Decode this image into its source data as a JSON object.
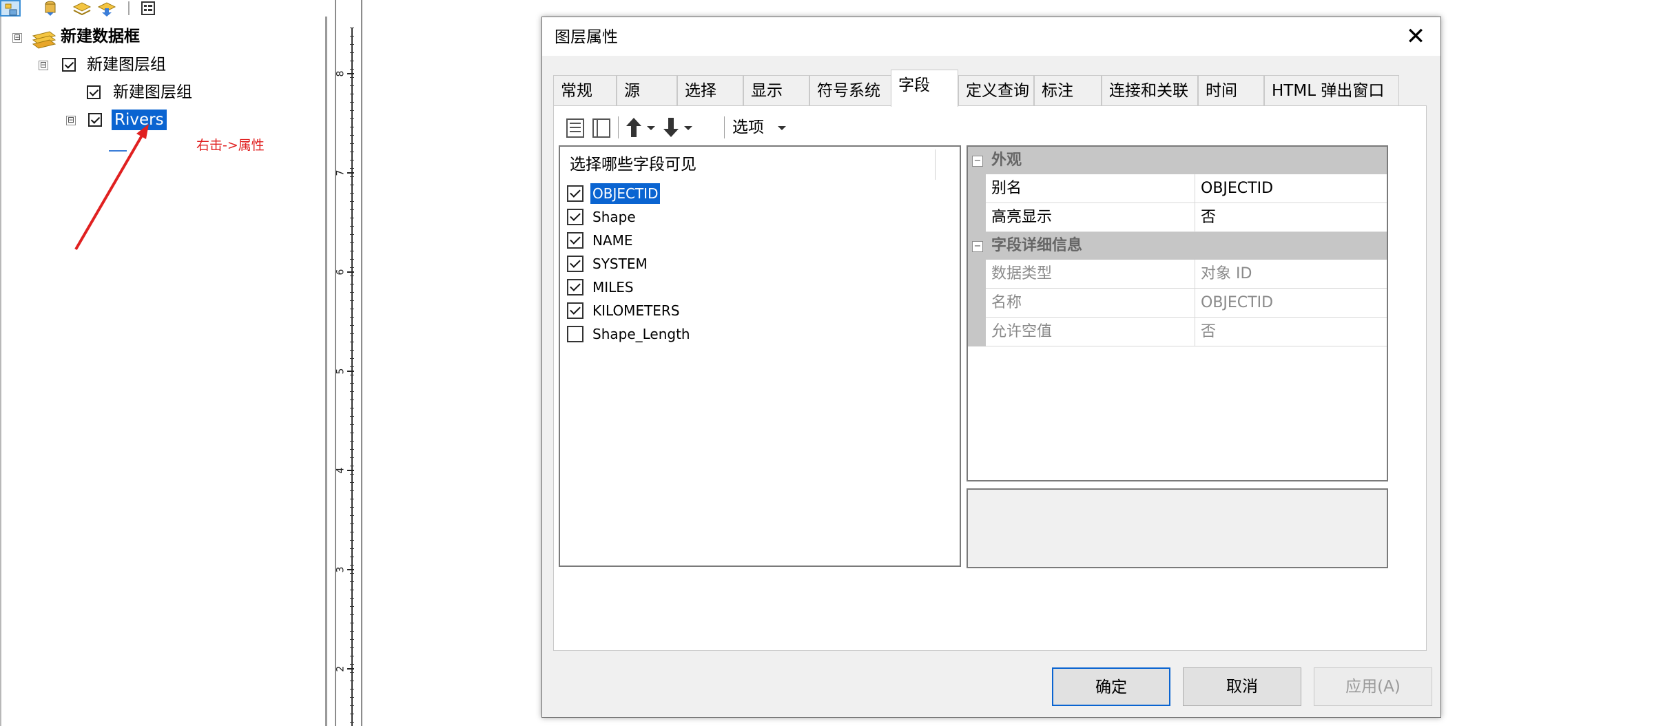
{
  "toc": {
    "data_frame": "新建数据框",
    "group_layer": "新建图层组",
    "sub_group_layer": "新建图层组",
    "rivers_layer": "Rivers",
    "annotation": "右击->属性",
    "expander_collapse_symbol": "⊟"
  },
  "ruler": {
    "ticks": [
      "8",
      "7",
      "6",
      "5",
      "4",
      "3",
      "2"
    ]
  },
  "dialog": {
    "title": "图层属性",
    "close_symbol": "✕",
    "tabs": [
      {
        "label": "常规"
      },
      {
        "label": "源"
      },
      {
        "label": "选择"
      },
      {
        "label": "显示"
      },
      {
        "label": "符号系统"
      },
      {
        "label": "字段"
      },
      {
        "label": "定义查询"
      },
      {
        "label": "标注"
      },
      {
        "label": "连接和关联"
      },
      {
        "label": "时间"
      },
      {
        "label": "HTML 弹出窗口"
      }
    ],
    "active_tab": "字段",
    "toolbar": {
      "options_label": "选项",
      "icons": [
        "list-view-icon",
        "blank-list-icon",
        "arrow-up-icon",
        "dropdown-icon",
        "arrow-down-icon",
        "dropdown-icon"
      ]
    },
    "field_list": {
      "header": "选择哪些字段可见",
      "fields": [
        {
          "name": "OBJECTID",
          "checked": true,
          "selected": true
        },
        {
          "name": "Shape",
          "checked": true,
          "selected": false
        },
        {
          "name": "NAME",
          "checked": true,
          "selected": false
        },
        {
          "name": "SYSTEM",
          "checked": true,
          "selected": false
        },
        {
          "name": "MILES",
          "checked": true,
          "selected": false
        },
        {
          "name": "KILOMETERS",
          "checked": true,
          "selected": false
        },
        {
          "name": "Shape_Length",
          "checked": false,
          "selected": false
        }
      ]
    },
    "property_grid": {
      "cat_appearance": "外观",
      "alias_name": "别名",
      "alias_value": "OBJECTID",
      "highlight_name": "高亮显示",
      "highlight_value": "否",
      "cat_details": "字段详细信息",
      "datatype_name": "数据类型",
      "datatype_value": "对象 ID",
      "fieldname_name": "名称",
      "fieldname_value": "OBJECTID",
      "nullable_name": "允许空值",
      "nullable_value": "否",
      "collapse_symbol": "−"
    },
    "buttons": {
      "ok": "确定",
      "cancel": "取消",
      "apply": "应用(A)"
    }
  },
  "colors": {
    "selection": "#0a64d1",
    "annotation": "#e02020",
    "dialog_bg": "#f0f0f0"
  }
}
